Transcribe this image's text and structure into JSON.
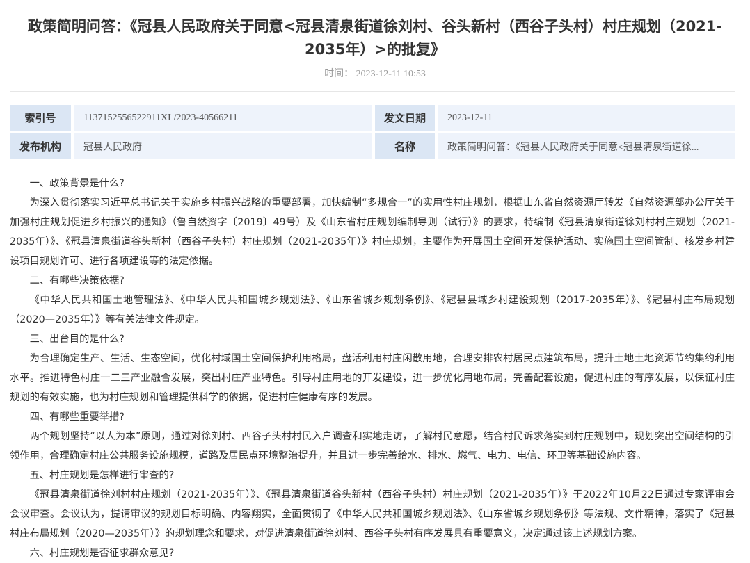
{
  "article": {
    "title": "政策简明问答：《冠县人民政府关于同意<冠县清泉街道徐刘村、谷头新村（西谷子头村）村庄规划（2021-2035年）>的批复》",
    "time_label": "时间：",
    "time_value": "2023-12-11 10:53"
  },
  "meta": {
    "index_label": "索引号",
    "index_value": "1137152556522911XL/2023-40566211",
    "date_label": "发文日期",
    "date_value": "2023-12-11",
    "org_label": "发布机构",
    "org_value": "冠县人民政府",
    "name_label": "名称",
    "name_value": "政策简明问答：《冠县人民政府关于同意<冠县清泉街道徐..."
  },
  "paragraphs": [
    "一、政策背景是什么?",
    "为深入贯彻落实习近平总书记关于实施乡村振兴战略的重要部署，加快编制“多规合一”的实用性村庄规划，根据山东省自然资源厅转发《自然资源部办公厅关于加强村庄规划促进乡村振兴的通知》（鲁自然资字〔2019〕49号）及《山东省村庄规划编制导则（试行）》的要求，特编制《冠县清泉街道徐刘村村庄规划（2021-2035年）》、《冠县清泉街道谷头新村（西谷子头村）村庄规划（2021-2035年）》村庄规划，主要作为开展国土空间开发保护活动、实施国土空间管制、核发乡村建设项目规划许可、进行各项建设等的法定依据。",
    "二、有哪些决策依据?",
    "《中华人民共和国土地管理法》、《中华人民共和国城乡规划法》、《山东省城乡规划条例》、《冠县县域乡村建设规划（2017-2035年）》、《冠县村庄布局规划（2020—2035年）》等有关法律文件规定。",
    "三、出台目的是什么?",
    "为合理确定生产、生活、生态空间，优化村域国土空间保护利用格局，盘活利用村庄闲散用地，合理安排农村居民点建筑布局，提升土地土地资源节约集约利用水平。推进特色村庄一二三产业融合发展，突出村庄产业特色。引导村庄用地的开发建设，进一步优化用地布局，完善配套设施，促进村庄的有序发展，以保证村庄规划的有效实施，也为村庄规划和管理提供科学的依据，促进村庄健康有序的发展。",
    "四、有哪些重要举措?",
    "两个规划坚持“以人为本”原则，通过对徐刘村、西谷子头村村民入户调查和实地走访，了解村民意愿，结合村民诉求落实到村庄规划中，规划突出空间结构的引领作用，合理确定村庄公共服务设施规模，道路及居民点环境整治提升，并且进一步完善给水、排水、燃气、电力、电信、环卫等基础设施内容。",
    "五、村庄规划是怎样进行审查的?",
    "《冠县清泉街道徐刘村村庄规划（2021-2035年）》、《冠县清泉街道谷头新村（西谷子头村）村庄规划（2021-2035年）》于2022年10月22日通过专家评审会会议审查。会议认为，提请审议的规划目标明确、内容翔实，全面贯彻了《中华人民共和国城乡规划法》、《山东省城乡规划条例》等法规、文件精神，落实了《冠县村庄布局规划（2020—2035年）》的规划理念和要求，对促进清泉街道徐刘村、西谷子头村有序发展具有重要意义，决定通过该上述规划方案。",
    "六、村庄规划是否征求群众意见?"
  ]
}
